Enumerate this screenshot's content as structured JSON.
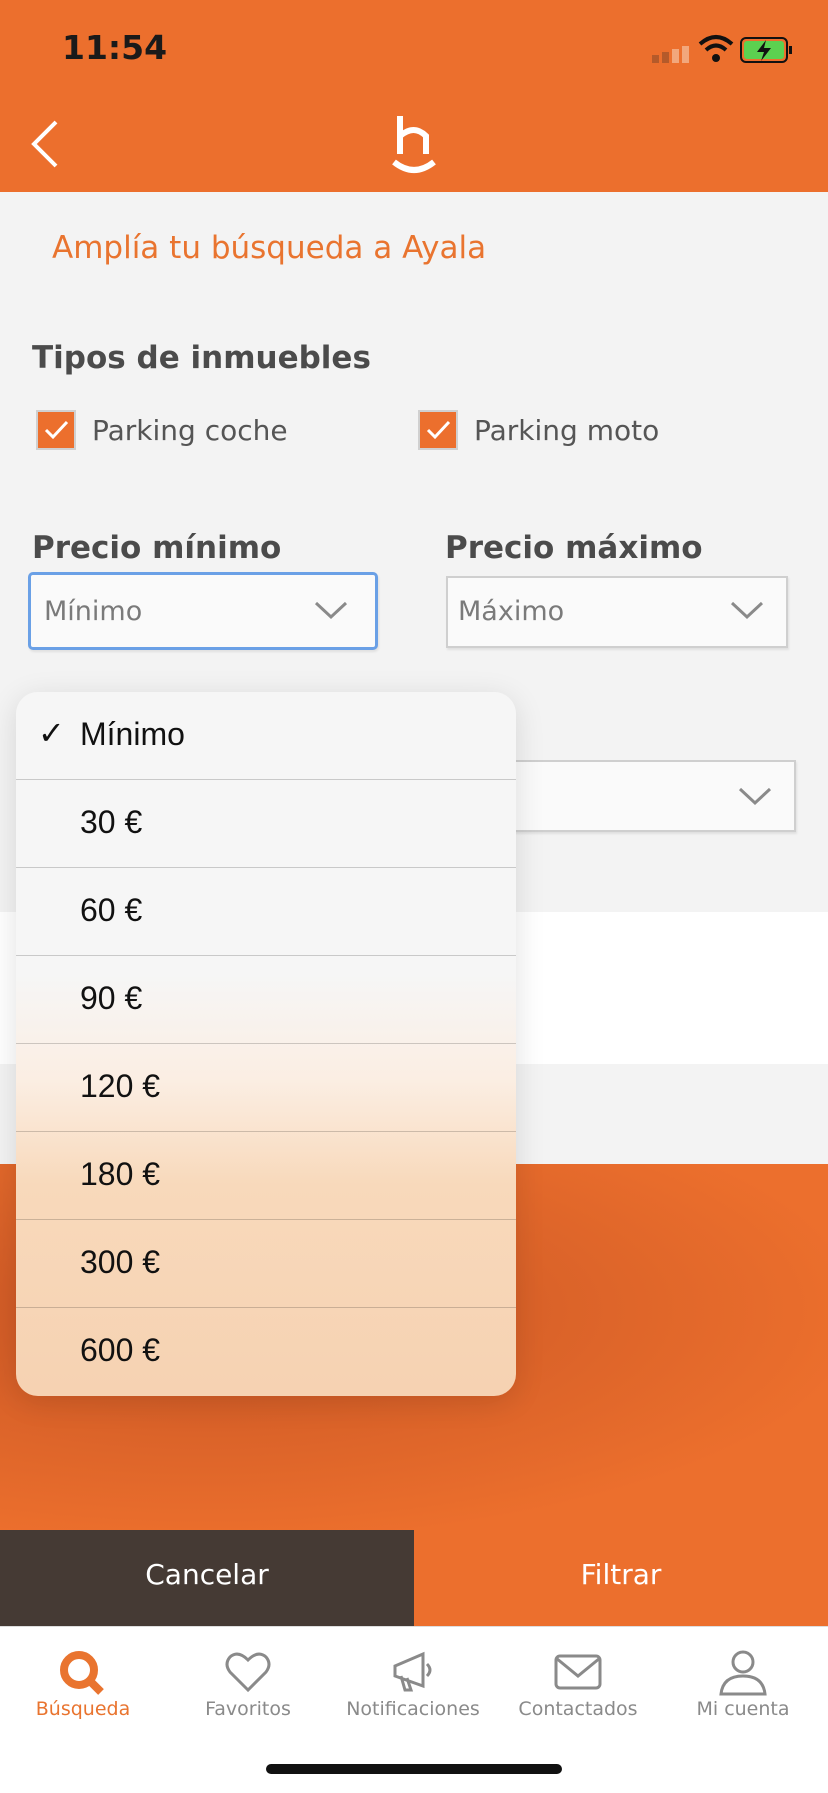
{
  "status_bar": {
    "time": "11:54"
  },
  "header": {
    "logo_icon": "h-smile-logo-icon",
    "back_icon": "chevron-left-icon"
  },
  "content": {
    "expand_link": "Amplía tu búsqueda a Ayala",
    "property_types": {
      "title": "Tipos de inmuebles",
      "options": [
        {
          "label": "Parking coche",
          "checked": true
        },
        {
          "label": "Parking moto",
          "checked": true
        }
      ]
    },
    "price_min": {
      "title": "Precio mínimo",
      "placeholder": "Mínimo"
    },
    "price_max": {
      "title": "Precio máximo",
      "placeholder": "Máximo"
    }
  },
  "dropdown": {
    "options": [
      {
        "label": "Mínimo",
        "selected": true
      },
      {
        "label": "30 €"
      },
      {
        "label": "60 €"
      },
      {
        "label": "90 €"
      },
      {
        "label": "120 €"
      },
      {
        "label": "180 €"
      },
      {
        "label": "300 €"
      },
      {
        "label": "600 €"
      }
    ],
    "selected_mark": "✓"
  },
  "actions": {
    "cancel": "Cancelar",
    "filter": "Filtrar"
  },
  "tabs": [
    {
      "label": "Búsqueda",
      "icon": "search-icon",
      "active": true
    },
    {
      "label": "Favoritos",
      "icon": "heart-icon"
    },
    {
      "label": "Notificaciones",
      "icon": "megaphone-icon"
    },
    {
      "label": "Contactados",
      "icon": "mail-icon"
    },
    {
      "label": "Mi cuenta",
      "icon": "user-icon"
    }
  ],
  "colors": {
    "brand": "#ec6f2d",
    "dark": "#453a34",
    "focus": "#6aa0e6"
  }
}
